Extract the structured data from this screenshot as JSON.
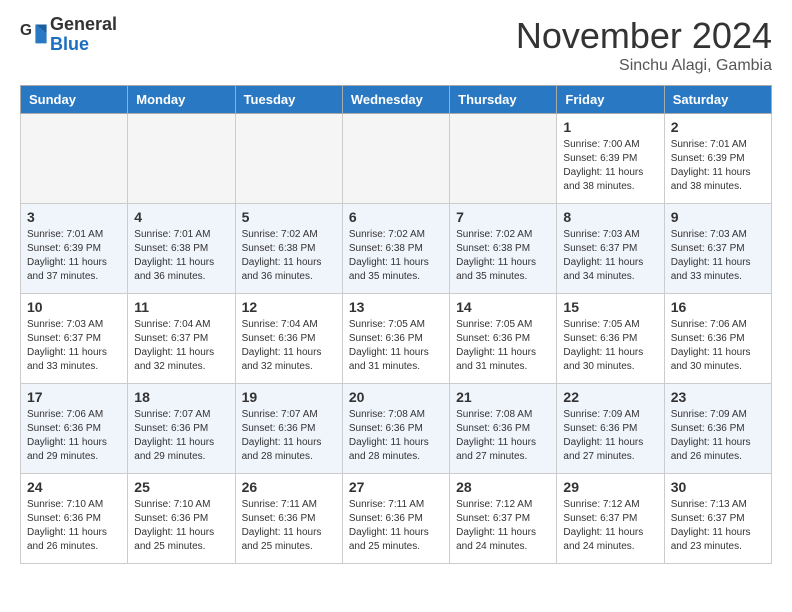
{
  "header": {
    "logo": {
      "general": "General",
      "blue": "Blue"
    },
    "month": "November 2024",
    "location": "Sinchu Alagi, Gambia"
  },
  "weekdays": [
    "Sunday",
    "Monday",
    "Tuesday",
    "Wednesday",
    "Thursday",
    "Friday",
    "Saturday"
  ],
  "weeks": [
    [
      {
        "day": "",
        "info": ""
      },
      {
        "day": "",
        "info": ""
      },
      {
        "day": "",
        "info": ""
      },
      {
        "day": "",
        "info": ""
      },
      {
        "day": "",
        "info": ""
      },
      {
        "day": "1",
        "info": "Sunrise: 7:00 AM\nSunset: 6:39 PM\nDaylight: 11 hours\nand 38 minutes."
      },
      {
        "day": "2",
        "info": "Sunrise: 7:01 AM\nSunset: 6:39 PM\nDaylight: 11 hours\nand 38 minutes."
      }
    ],
    [
      {
        "day": "3",
        "info": "Sunrise: 7:01 AM\nSunset: 6:39 PM\nDaylight: 11 hours\nand 37 minutes."
      },
      {
        "day": "4",
        "info": "Sunrise: 7:01 AM\nSunset: 6:38 PM\nDaylight: 11 hours\nand 36 minutes."
      },
      {
        "day": "5",
        "info": "Sunrise: 7:02 AM\nSunset: 6:38 PM\nDaylight: 11 hours\nand 36 minutes."
      },
      {
        "day": "6",
        "info": "Sunrise: 7:02 AM\nSunset: 6:38 PM\nDaylight: 11 hours\nand 35 minutes."
      },
      {
        "day": "7",
        "info": "Sunrise: 7:02 AM\nSunset: 6:38 PM\nDaylight: 11 hours\nand 35 minutes."
      },
      {
        "day": "8",
        "info": "Sunrise: 7:03 AM\nSunset: 6:37 PM\nDaylight: 11 hours\nand 34 minutes."
      },
      {
        "day": "9",
        "info": "Sunrise: 7:03 AM\nSunset: 6:37 PM\nDaylight: 11 hours\nand 33 minutes."
      }
    ],
    [
      {
        "day": "10",
        "info": "Sunrise: 7:03 AM\nSunset: 6:37 PM\nDaylight: 11 hours\nand 33 minutes."
      },
      {
        "day": "11",
        "info": "Sunrise: 7:04 AM\nSunset: 6:37 PM\nDaylight: 11 hours\nand 32 minutes."
      },
      {
        "day": "12",
        "info": "Sunrise: 7:04 AM\nSunset: 6:36 PM\nDaylight: 11 hours\nand 32 minutes."
      },
      {
        "day": "13",
        "info": "Sunrise: 7:05 AM\nSunset: 6:36 PM\nDaylight: 11 hours\nand 31 minutes."
      },
      {
        "day": "14",
        "info": "Sunrise: 7:05 AM\nSunset: 6:36 PM\nDaylight: 11 hours\nand 31 minutes."
      },
      {
        "day": "15",
        "info": "Sunrise: 7:05 AM\nSunset: 6:36 PM\nDaylight: 11 hours\nand 30 minutes."
      },
      {
        "day": "16",
        "info": "Sunrise: 7:06 AM\nSunset: 6:36 PM\nDaylight: 11 hours\nand 30 minutes."
      }
    ],
    [
      {
        "day": "17",
        "info": "Sunrise: 7:06 AM\nSunset: 6:36 PM\nDaylight: 11 hours\nand 29 minutes."
      },
      {
        "day": "18",
        "info": "Sunrise: 7:07 AM\nSunset: 6:36 PM\nDaylight: 11 hours\nand 29 minutes."
      },
      {
        "day": "19",
        "info": "Sunrise: 7:07 AM\nSunset: 6:36 PM\nDaylight: 11 hours\nand 28 minutes."
      },
      {
        "day": "20",
        "info": "Sunrise: 7:08 AM\nSunset: 6:36 PM\nDaylight: 11 hours\nand 28 minutes."
      },
      {
        "day": "21",
        "info": "Sunrise: 7:08 AM\nSunset: 6:36 PM\nDaylight: 11 hours\nand 27 minutes."
      },
      {
        "day": "22",
        "info": "Sunrise: 7:09 AM\nSunset: 6:36 PM\nDaylight: 11 hours\nand 27 minutes."
      },
      {
        "day": "23",
        "info": "Sunrise: 7:09 AM\nSunset: 6:36 PM\nDaylight: 11 hours\nand 26 minutes."
      }
    ],
    [
      {
        "day": "24",
        "info": "Sunrise: 7:10 AM\nSunset: 6:36 PM\nDaylight: 11 hours\nand 26 minutes."
      },
      {
        "day": "25",
        "info": "Sunrise: 7:10 AM\nSunset: 6:36 PM\nDaylight: 11 hours\nand 25 minutes."
      },
      {
        "day": "26",
        "info": "Sunrise: 7:11 AM\nSunset: 6:36 PM\nDaylight: 11 hours\nand 25 minutes."
      },
      {
        "day": "27",
        "info": "Sunrise: 7:11 AM\nSunset: 6:36 PM\nDaylight: 11 hours\nand 25 minutes."
      },
      {
        "day": "28",
        "info": "Sunrise: 7:12 AM\nSunset: 6:37 PM\nDaylight: 11 hours\nand 24 minutes."
      },
      {
        "day": "29",
        "info": "Sunrise: 7:12 AM\nSunset: 6:37 PM\nDaylight: 11 hours\nand 24 minutes."
      },
      {
        "day": "30",
        "info": "Sunrise: 7:13 AM\nSunset: 6:37 PM\nDaylight: 11 hours\nand 23 minutes."
      }
    ]
  ]
}
